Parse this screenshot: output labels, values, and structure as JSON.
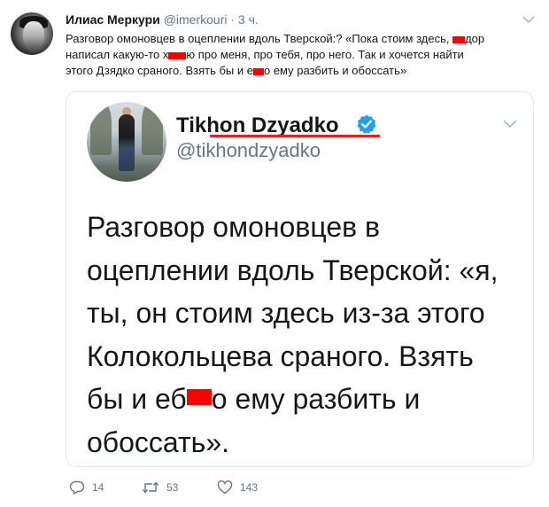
{
  "tweet": {
    "author_name": "Илиас Меркури",
    "author_handle": "@imerkouri",
    "separator": "·",
    "time": "3 ч.",
    "text": {
      "l1a": "Разговор омоновцев в оцеплении вдоль Тверской:? «Пока стоим здесь, ",
      "l1b": "дор",
      "l2a": "написал какую-то х",
      "l2b": "ю про меня, про тебя, про него. Так и хочется найти",
      "l3a": "этого Дзядко сраного. Взять бы и е",
      "l3b": "о ему разбить и обоссать»"
    }
  },
  "quoted": {
    "name": "Tikhon Dzyadko",
    "handle": "@tikhondzyadko",
    "lines": {
      "l1": "Разговор омоновцев в",
      "l2": "оцеплении вдоль Тверской: «я,",
      "l3": "ты, он стоим здесь из-за этого",
      "l4": "Колокольцева сраного. Взять",
      "l5a": "бы и еб",
      "l5b": "о ему разбить и",
      "l6": "обоссать»."
    }
  },
  "actions": {
    "replies": "14",
    "retweets": "53",
    "likes": "143"
  },
  "icons": [
    "chevron-down-icon",
    "verified-badge-icon",
    "reply-icon",
    "retweet-icon",
    "like-icon"
  ],
  "colors": {
    "text": "#14171a",
    "secondary": "#657786",
    "border": "#e1e8ed",
    "verified": "#1da1f2",
    "redaction": "#ff0000",
    "underline": "#e0231c"
  }
}
